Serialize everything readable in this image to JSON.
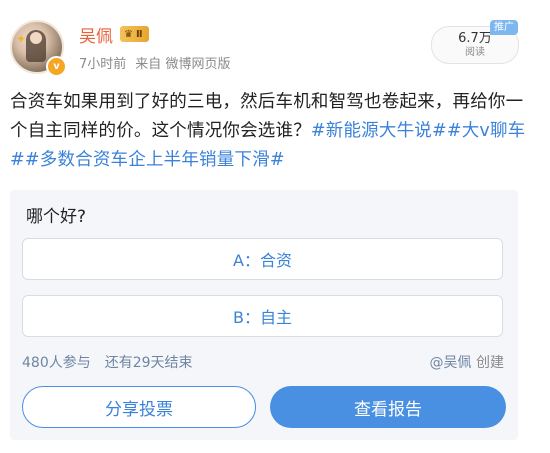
{
  "user": {
    "name": "吴佩",
    "level": "Ⅱ",
    "meta": {
      "time": "7小时前",
      "source_prefix": "来自",
      "source": "微博网页版"
    }
  },
  "read": {
    "count": "6.7万",
    "label": "阅读",
    "promo": "推广"
  },
  "post": {
    "text": "合资车如果用到了好的三电，然后车机和智驾也卷起来，再给你一个自主同样的价。这个情况你会选谁？",
    "hashtags": [
      "#新能源大牛说#",
      "#大v聊车#",
      "#多数合资车企上半年销量下滑#"
    ]
  },
  "poll": {
    "question": "哪个好?",
    "options": [
      {
        "label": "A：合资"
      },
      {
        "label": "B：自主"
      }
    ],
    "participants": "480人参与",
    "remaining": "还有29天结束",
    "creator_name": "@吴佩",
    "creator_suffix": "创建",
    "share_label": "分享投票",
    "report_label": "查看报告"
  },
  "colors": {
    "accent": "#4a90e2",
    "hashtag": "#3b82d9",
    "username": "#e8613c",
    "poll_bg": "#f4f6fa"
  }
}
